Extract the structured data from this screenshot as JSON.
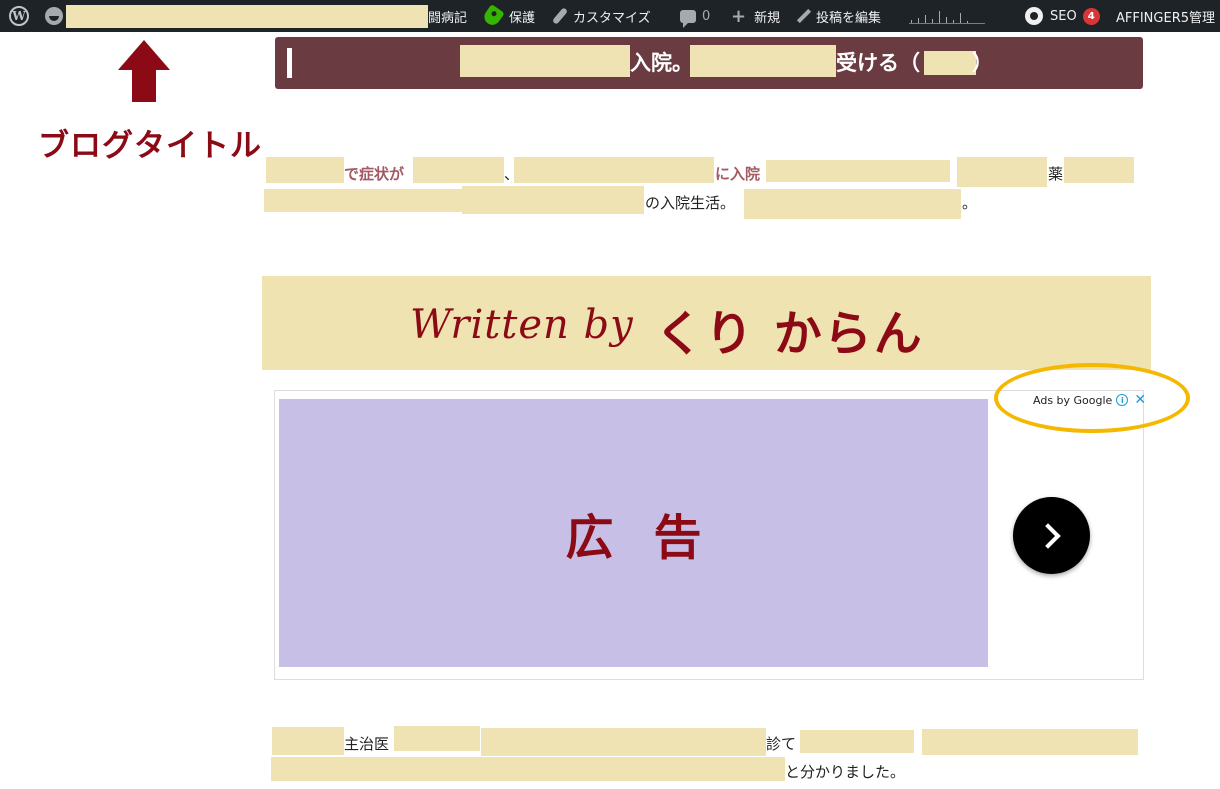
{
  "admin_bar": {
    "site_title_suffix": "闘病記",
    "protect_label": "保護",
    "customize_label": "カスタマイズ",
    "comments_count": "0",
    "new_label": "新規",
    "edit_post_label": "投稿を編集",
    "seo_label": "SEO",
    "seo_badge": "4",
    "affinger_label": "AFFINGER5管理"
  },
  "annotation": {
    "blog_title_label": "ブログタイトル"
  },
  "post": {
    "title_part1": "入院。",
    "title_part2": "受ける（",
    "title_part3": "）",
    "intro": {
      "line1_a": "で症状が",
      "line1_b": "、",
      "line1_c": "に入院",
      "line1_d": "薬",
      "line2_a": "の入院生活。",
      "line2_b": "。"
    },
    "body": {
      "line1_a": "主治医",
      "line1_b": "診て",
      "line2_a": "と分かりました。"
    }
  },
  "written_by": {
    "script_text": "Written by",
    "author_name": "くり からん"
  },
  "ad": {
    "label": "広告",
    "ads_by_text": "Ads by Google",
    "info_icon": "i",
    "close_icon": "✕"
  },
  "colors": {
    "brand_dark_red": "#8b0a15",
    "title_banner_bg": "#6b3b42",
    "redaction": "#efe3b3",
    "ad_bg": "#c8bfe6",
    "highlight": "#f5b800"
  }
}
